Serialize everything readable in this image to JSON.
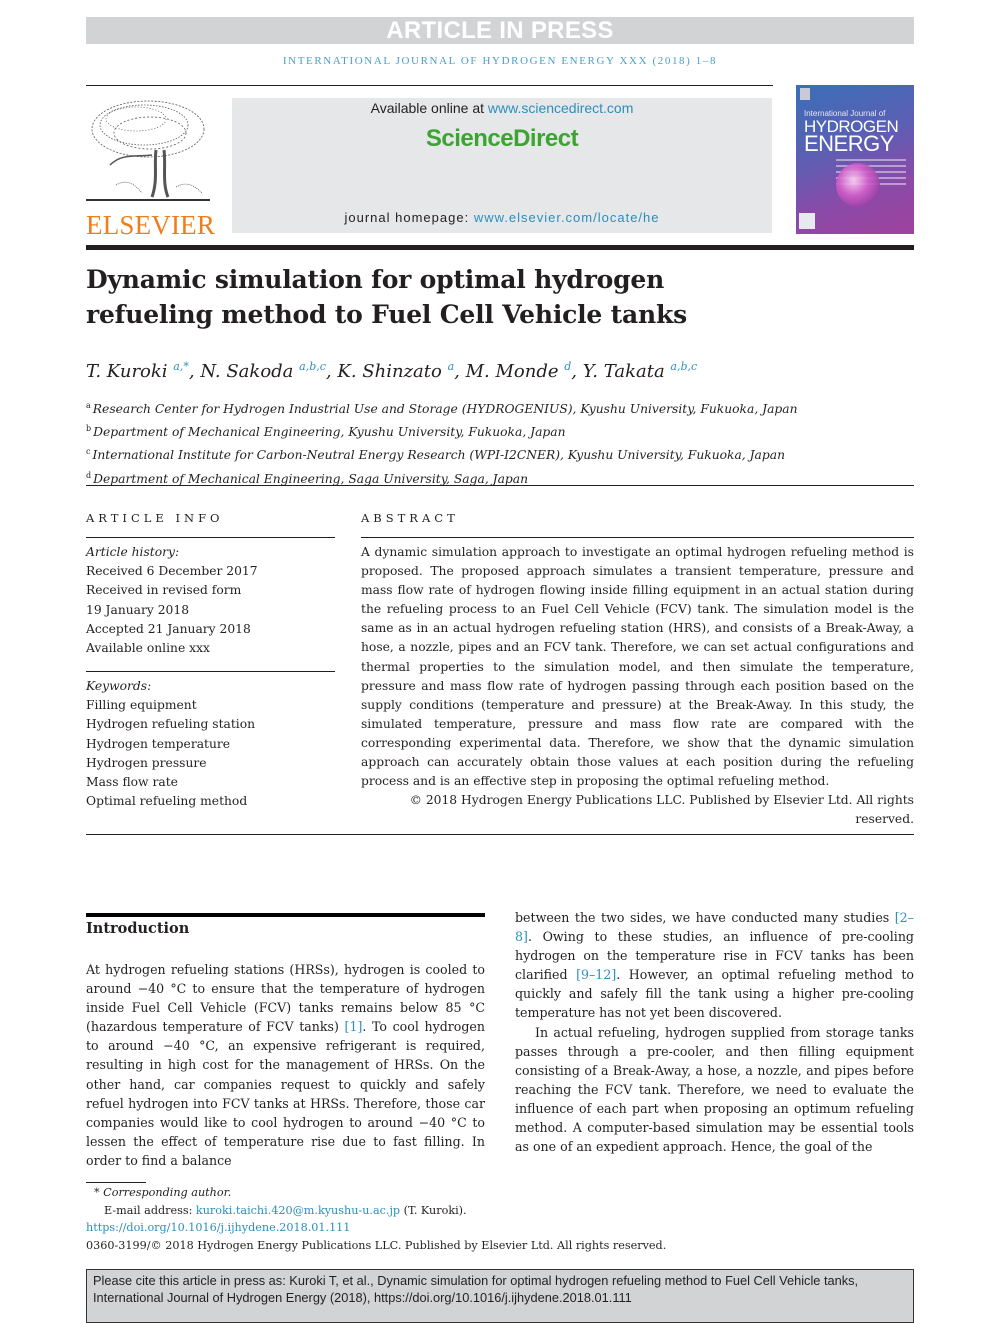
{
  "banner": "ARTICLE IN PRESS",
  "journal_line": "International Journal of Hydrogen Energy xxx (2018) 1–8",
  "header": {
    "publisher_logo_text": "ELSEVIER",
    "available_online_prefix": "Available online at ",
    "available_online_link": "www.sciencedirect.com",
    "sciencedirect_logo": "ScienceDirect",
    "homepage_prefix": "journal homepage: ",
    "homepage_link": "www.elsevier.com/locate/he",
    "cover": {
      "small_line": "International Journal of",
      "title_line1": "HYDROGEN",
      "title_line2": "ENERGY"
    }
  },
  "title": "Dynamic simulation for optimal hydrogen refueling method to Fuel Cell Vehicle tanks",
  "authors": [
    {
      "name": "T. Kuroki",
      "sup": "a,*"
    },
    {
      "name": "N. Sakoda",
      "sup": "a,b,c"
    },
    {
      "name": "K. Shinzato",
      "sup": "a"
    },
    {
      "name": "M. Monde",
      "sup": "d"
    },
    {
      "name": "Y. Takata",
      "sup": "a,b,c"
    }
  ],
  "affiliations": [
    {
      "key": "a",
      "text": "Research Center for Hydrogen Industrial Use and Storage (HYDROGENIUS), Kyushu University, Fukuoka, Japan"
    },
    {
      "key": "b",
      "text": "Department of Mechanical Engineering, Kyushu University, Fukuoka, Japan"
    },
    {
      "key": "c",
      "text": "International Institute for Carbon-Neutral Energy Research (WPI-I2CNER), Kyushu University, Fukuoka, Japan"
    },
    {
      "key": "d",
      "text": "Department of Mechanical Engineering, Saga University, Saga, Japan"
    }
  ],
  "article_info": {
    "heading": "ARTICLE INFO",
    "history_label": "Article history:",
    "history": [
      "Received 6 December 2017",
      "Received in revised form",
      "19 January 2018",
      "Accepted 21 January 2018",
      "Available online xxx"
    ],
    "keywords_label": "Keywords:",
    "keywords": [
      "Filling equipment",
      "Hydrogen refueling station",
      "Hydrogen temperature",
      "Hydrogen pressure",
      "Mass flow rate",
      "Optimal refueling method"
    ]
  },
  "abstract": {
    "heading": "ABSTRACT",
    "text": "A dynamic simulation approach to investigate an optimal hydrogen refueling method is proposed. The proposed approach simulates a transient temperature, pressure and mass flow rate of hydrogen flowing inside filling equipment in an actual station during the refueling process to an Fuel Cell Vehicle (FCV) tank. The simulation model is the same as in an actual hydrogen refueling station (HRS), and consists of a Break-Away, a hose, a nozzle, pipes and an FCV tank. Therefore, we can set actual configurations and thermal properties to the simulation model, and then simulate the temperature, pressure and mass flow rate of hydrogen passing through each position based on the supply conditions (temperature and pressure) at the Break-Away. In this study, the simulated temperature, pressure and mass flow rate are compared with the corresponding experimental data. Therefore, we show that the dynamic simulation approach can accurately obtain those values at each position during the refueling process and is an effective step in proposing the optimal refueling method.",
    "copyright": "© 2018 Hydrogen Energy Publications LLC. Published by Elsevier Ltd. All rights reserved."
  },
  "introduction": {
    "heading": "Introduction",
    "left_p1_a": "At hydrogen refueling stations (HRSs), hydrogen is cooled to around −40 °C to ensure that the temperature of hydrogen inside Fuel Cell Vehicle (FCV) tanks remains below 85 °C (hazardous temperature of FCV tanks) ",
    "ref1": "[1]",
    "left_p1_b": ". To cool hydrogen to around −40 °C, an expensive refrigerant is required, resulting in high cost for the management of HRSs. On the other hand, car companies request to quickly and safely refuel hydrogen into FCV tanks at HRSs. Therefore, those car companies would like to cool hydrogen to around −40 °C to lessen the effect of temperature rise due to fast filling. In order to find a balance",
    "right_p1_a": "between the two sides, we have conducted many studies ",
    "ref2": "[2–8]",
    "right_p1_b": ". Owing to these studies, an influence of pre-cooling hydrogen on the temperature rise in FCV tanks has been clarified ",
    "ref3": "[9–12]",
    "right_p1_c": ". However, an optimal refueling method to quickly and safely fill the tank using a higher pre-cooling temperature has not yet been discovered.",
    "right_p2": "In actual refueling, hydrogen supplied from storage tanks passes through a pre-cooler, and then filling equipment consisting of a Break-Away, a hose, a nozzle, and pipes before reaching the FCV tank. Therefore, we need to evaluate the influence of each part when proposing an optimum refueling method. A computer-based simulation may be essential tools as one of an expedient approach. Hence, the goal of the"
  },
  "footnotes": {
    "corresponding": "Corresponding author.",
    "corresponding_mark": "*",
    "email_label": "E-mail address: ",
    "email": "kuroki.taichi.420@m.kyushu-u.ac.jp",
    "email_suffix": " (T. Kuroki).",
    "doi": "https://doi.org/10.1016/j.ijhydene.2018.01.111",
    "issn_line": "0360-3199/© 2018 Hydrogen Energy Publications LLC. Published by Elsevier Ltd. All rights reserved."
  },
  "citation_box": {
    "line1": "Please cite this article in press as: Kuroki T, et al., Dynamic simulation for optimal hydrogen refueling method to Fuel Cell Vehicle tanks,",
    "line2": "International Journal of Hydrogen Energy (2018), https://doi.org/10.1016/j.ijhydene.2018.01.111"
  },
  "colors": {
    "link": "#2a8fbd",
    "elsevier_orange": "#f07d1a",
    "sciencedirect_green": "#3da333",
    "banner_gray": "#d2d3d5"
  }
}
